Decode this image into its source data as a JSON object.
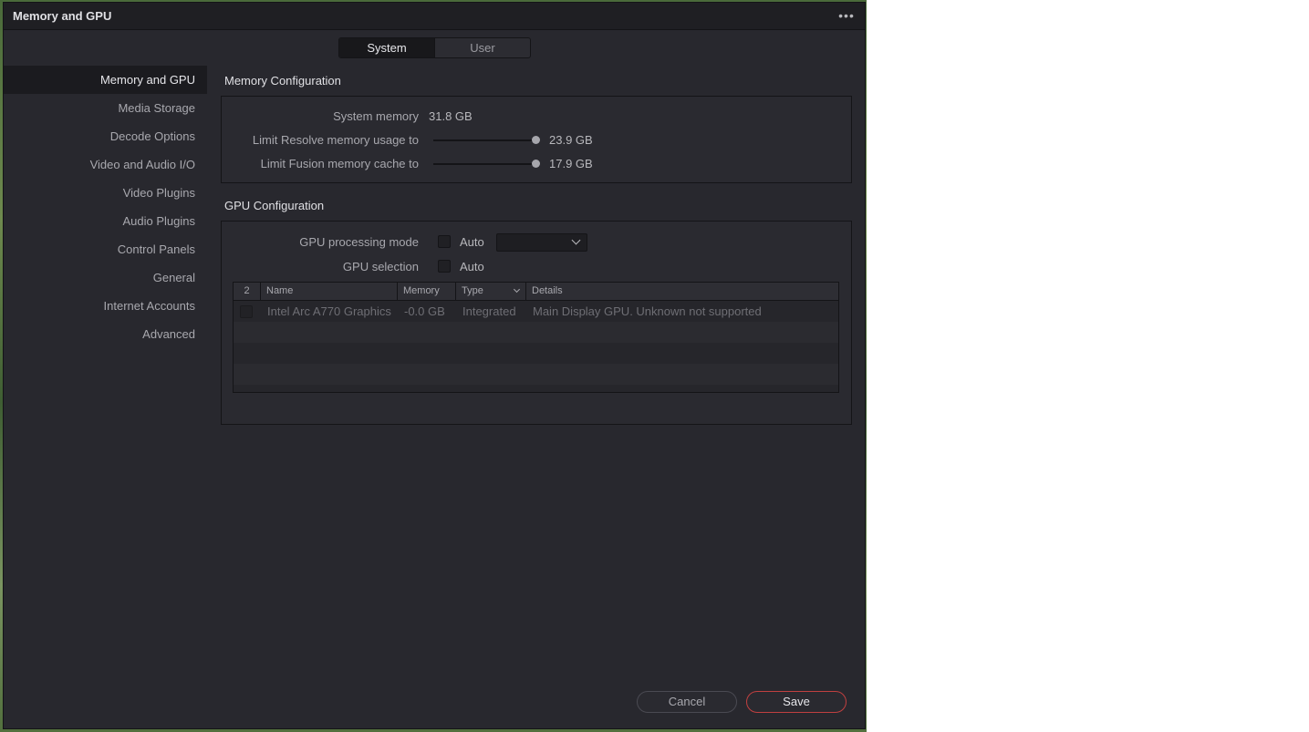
{
  "window": {
    "title": "Memory and GPU"
  },
  "tabs": [
    {
      "label": "System",
      "active": true
    },
    {
      "label": "User",
      "active": false
    }
  ],
  "sidebar": {
    "items": [
      {
        "label": "Memory and GPU",
        "active": true
      },
      {
        "label": "Media Storage"
      },
      {
        "label": "Decode Options"
      },
      {
        "label": "Video and Audio I/O"
      },
      {
        "label": "Video Plugins"
      },
      {
        "label": "Audio Plugins"
      },
      {
        "label": "Control Panels"
      },
      {
        "label": "General"
      },
      {
        "label": "Internet Accounts"
      },
      {
        "label": "Advanced"
      }
    ]
  },
  "memory": {
    "title": "Memory Configuration",
    "system_label": "System memory",
    "system_value": "31.8 GB",
    "resolve_label": "Limit Resolve memory usage to",
    "resolve_value": "23.9 GB",
    "resolve_fraction": 1.0,
    "fusion_label": "Limit Fusion memory cache to",
    "fusion_value": "17.9 GB",
    "fusion_fraction": 1.0
  },
  "gpu": {
    "title": "GPU Configuration",
    "mode_label": "GPU processing mode",
    "mode_auto_label": "Auto",
    "mode_auto_checked": false,
    "mode_dropdown_value": "",
    "selection_label": "GPU selection",
    "selection_auto_label": "Auto",
    "selection_auto_checked": false,
    "table": {
      "headers": [
        "2",
        "Name",
        "Memory",
        "Type",
        "Details"
      ],
      "rows": [
        {
          "checked": false,
          "name": "Intel Arc A770 Graphics",
          "memory": "-0.0 GB",
          "type": "Integrated",
          "details": "Main Display GPU. Unknown not supported"
        }
      ]
    }
  },
  "footer": {
    "cancel_label": "Cancel",
    "save_label": "Save"
  },
  "colors": {
    "window_bg": "#28282e",
    "accent_save_border": "#c04040"
  }
}
